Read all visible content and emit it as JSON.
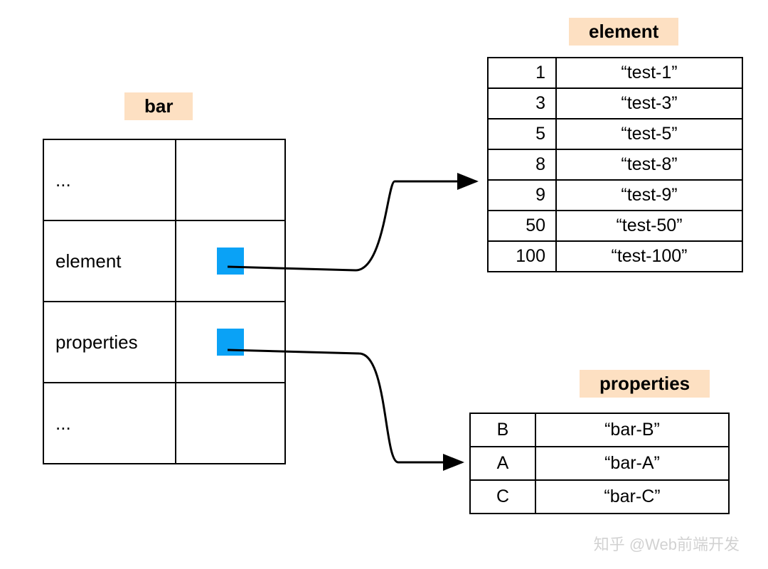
{
  "bar": {
    "label": "bar",
    "rows": [
      {
        "key": "...",
        "val": ""
      },
      {
        "key": "element",
        "val": "blue"
      },
      {
        "key": "properties",
        "val": "blue"
      },
      {
        "key": "...",
        "val": ""
      }
    ]
  },
  "element": {
    "label": "element",
    "rows": [
      {
        "k": "1",
        "v": "“test-1”"
      },
      {
        "k": "3",
        "v": "“test-3”"
      },
      {
        "k": "5",
        "v": "“test-5”"
      },
      {
        "k": "8",
        "v": "“test-8”"
      },
      {
        "k": "9",
        "v": "“test-9”"
      },
      {
        "k": "50",
        "v": "“test-50”"
      },
      {
        "k": "100",
        "v": "“test-100”"
      }
    ]
  },
  "properties": {
    "label": "properties",
    "rows": [
      {
        "k": "B",
        "v": "“bar-B”"
      },
      {
        "k": "A",
        "v": "“bar-A”"
      },
      {
        "k": "C",
        "v": "“bar-C”"
      }
    ]
  },
  "watermark": "知乎 @Web前端开发"
}
